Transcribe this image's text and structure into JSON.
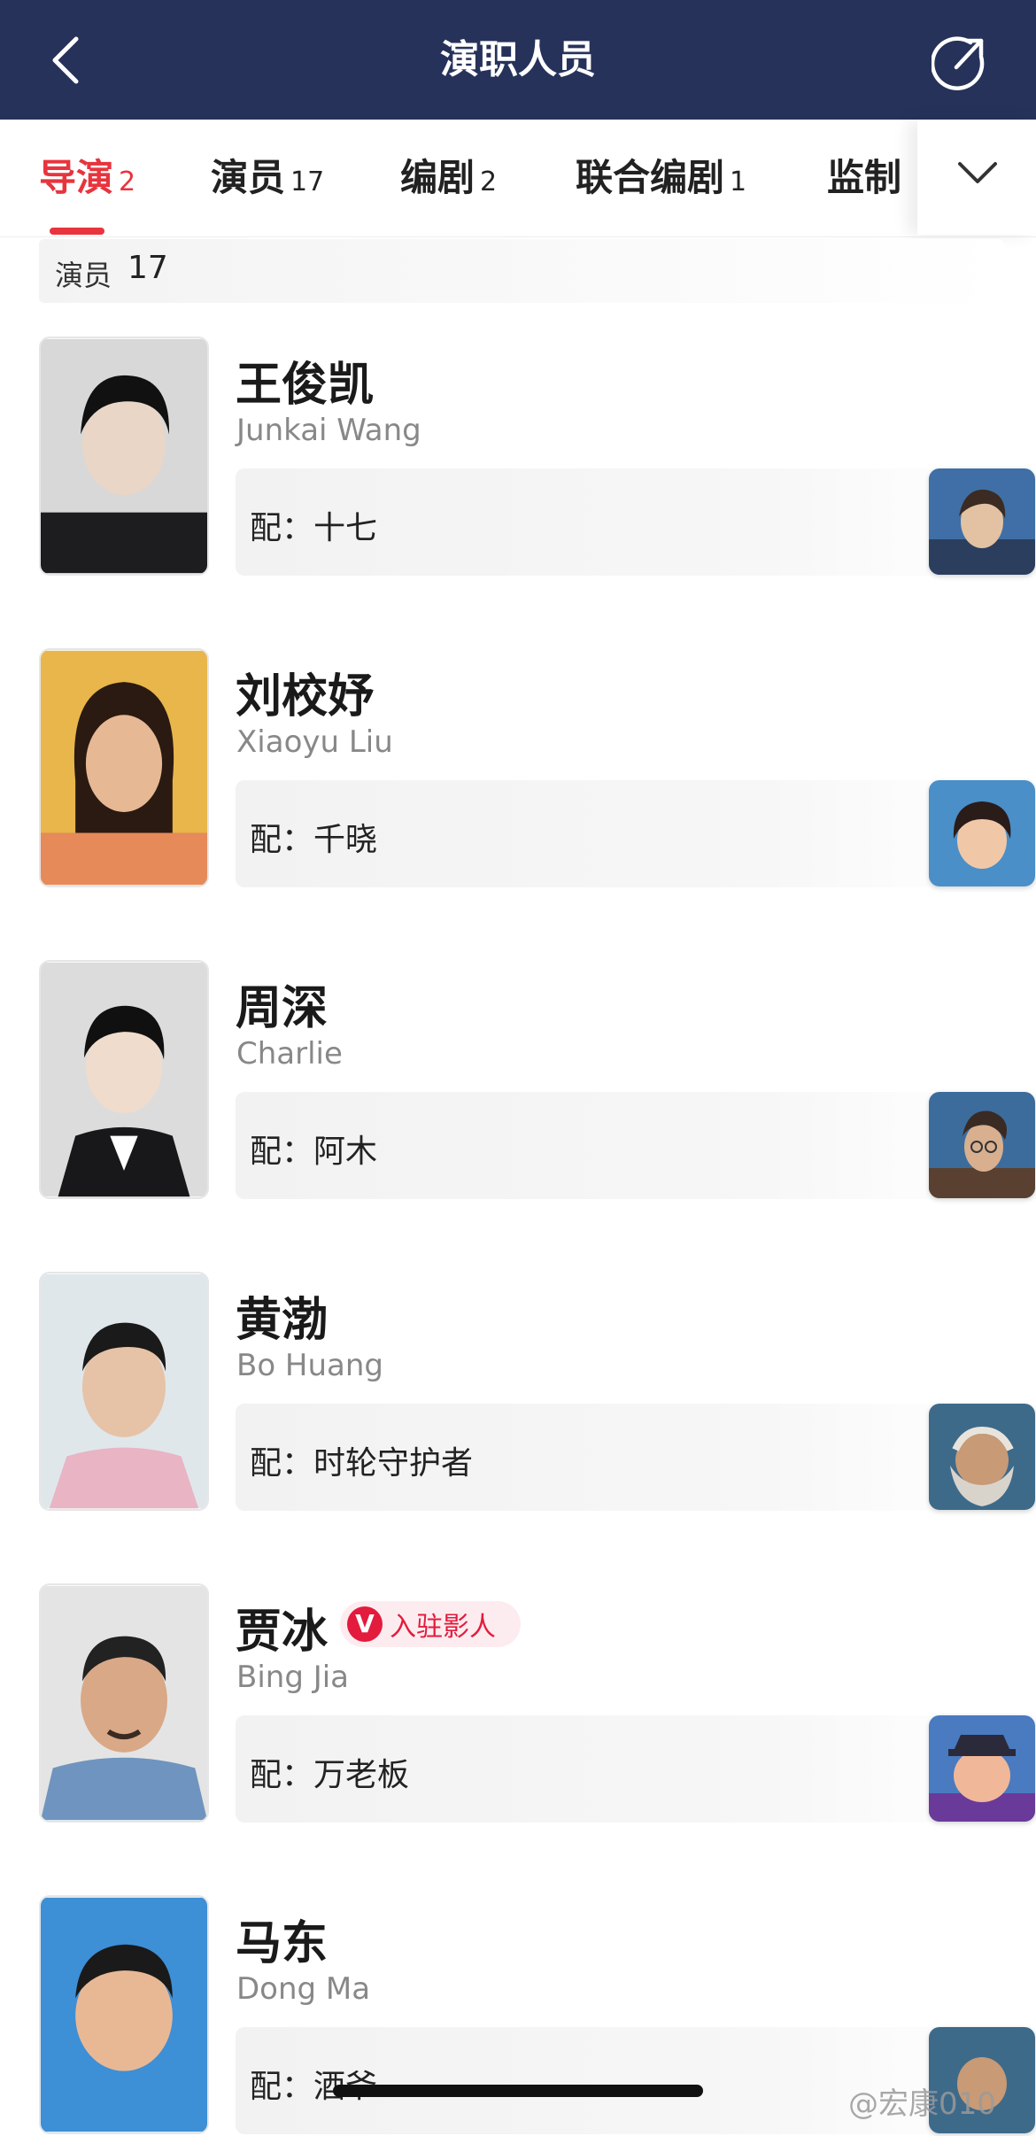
{
  "header": {
    "title": "演职人员",
    "back_icon": "chevron-left-icon",
    "share_icon": "share-icon"
  },
  "tabs": [
    {
      "label": "导演",
      "count": "2",
      "active": true
    },
    {
      "label": "演员",
      "count": "17"
    },
    {
      "label": "编剧",
      "count": "2"
    },
    {
      "label": "联合编剧",
      "count": "1"
    },
    {
      "label": "监制",
      "count": ""
    }
  ],
  "tabs_expand_icon": "chevron-down-icon",
  "section": {
    "label": "演员",
    "count": "17"
  },
  "cast": [
    {
      "cn": "王俊凯",
      "en": "Junkai Wang",
      "role": "配：十七"
    },
    {
      "cn": "刘校妤",
      "en": "Xiaoyu Liu",
      "role": "配：千晓"
    },
    {
      "cn": "周深",
      "en": "Charlie",
      "role": "配：阿木"
    },
    {
      "cn": "黄渤",
      "en": "Bo Huang",
      "role": "配：时轮守护者"
    },
    {
      "cn": "贾冰",
      "en": "Bing Jia",
      "role": "配：万老板",
      "badge": "入驻影人",
      "badge_mark": "V"
    },
    {
      "cn": "马东",
      "en": "Dong Ma",
      "role": "配：酒爷"
    }
  ],
  "watermark": "@宏康010",
  "colors": {
    "header_bg": "#26325a",
    "accent": "#e8343d",
    "badge": "#e31b3d"
  }
}
